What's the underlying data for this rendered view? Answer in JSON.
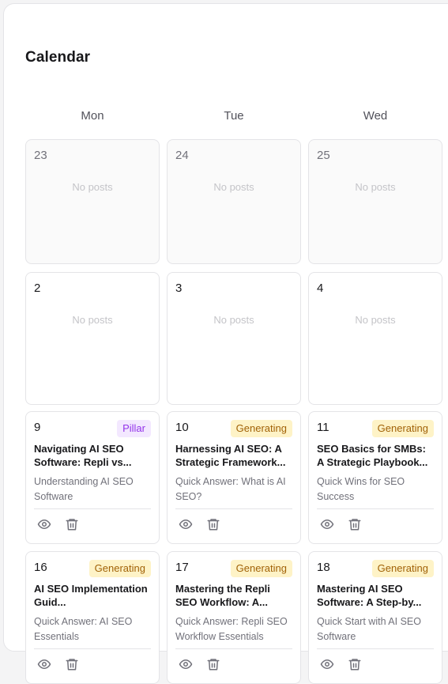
{
  "page": {
    "title": "Calendar"
  },
  "days": [
    "Mon",
    "Tue",
    "Wed"
  ],
  "empty_label": "No posts",
  "icons": {
    "view": "eye-icon",
    "delete": "trash-icon"
  },
  "colors": {
    "pillar_bg": "#f3e8ff",
    "pillar_text": "#9333ea",
    "generating_bg": "#fef3c7",
    "generating_text": "#a16207"
  },
  "weeks": [
    [
      {
        "date": "23",
        "posts": []
      },
      {
        "date": "24",
        "posts": []
      },
      {
        "date": "25",
        "posts": []
      }
    ],
    [
      {
        "date": "2",
        "posts": []
      },
      {
        "date": "3",
        "posts": []
      },
      {
        "date": "4",
        "posts": []
      }
    ],
    [
      {
        "date": "9",
        "posts": [
          {
            "badge": "Pillar",
            "title": "Navigating AI SEO Software: Repli vs...",
            "subtitle": "Understanding AI SEO Software"
          }
        ]
      },
      {
        "date": "10",
        "posts": [
          {
            "badge": "Generating",
            "title": "Harnessing AI SEO: A Strategic Framework...",
            "subtitle": "Quick Answer: What is AI SEO?"
          }
        ]
      },
      {
        "date": "11",
        "posts": [
          {
            "badge": "Generating",
            "title": "SEO Basics for SMBs: A Strategic Playbook...",
            "subtitle": "Quick Wins for SEO Success"
          }
        ]
      }
    ],
    [
      {
        "date": "16",
        "posts": [
          {
            "badge": "Generating",
            "title": "AI SEO Implementation Guid...",
            "subtitle": "Quick Answer: AI SEO Essentials"
          }
        ]
      },
      {
        "date": "17",
        "posts": [
          {
            "badge": "Generating",
            "title": "Mastering the Repli SEO Workflow: A...",
            "subtitle": "Quick Answer: Repli SEO Workflow Essentials"
          }
        ]
      },
      {
        "date": "18",
        "posts": [
          {
            "badge": "Generating",
            "title": "Mastering AI SEO Software: A Step-by...",
            "subtitle": "Quick Start with AI SEO Software"
          }
        ]
      }
    ]
  ]
}
